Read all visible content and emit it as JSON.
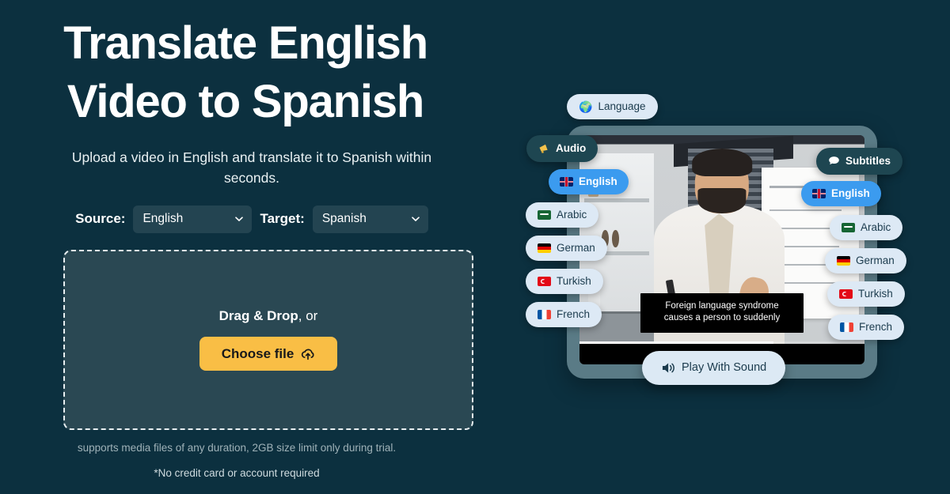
{
  "hero": {
    "title_line1": "Translate English",
    "title_line2": "Video to Spanish",
    "subtitle": "Upload a video in English and translate it to Spanish within seconds."
  },
  "form": {
    "source_label": "Source:",
    "source_value": "English",
    "source_options": [
      "English"
    ],
    "target_label": "Target:",
    "target_value": "Spanish",
    "target_options": [
      "Spanish"
    ],
    "dropzone": {
      "drag_strong": "Drag & Drop",
      "drag_rest": ", or",
      "button_label": "Choose file",
      "button_icon": "cloud-upload-icon"
    },
    "fineprint_1": "supports media files of any duration, 2GB size limit only during trial.",
    "fineprint_2": "*No credit card or account required"
  },
  "preview": {
    "language_chip": {
      "label": "Language",
      "icon": "globe-icon"
    },
    "audio_chip": {
      "label": "Audio",
      "icon": "megaphone-icon"
    },
    "subtitles_chip": {
      "label": "Subtitles",
      "icon": "speech-bubble-icon"
    },
    "audio_languages": [
      {
        "label": "English",
        "flag": "flag-gb",
        "selected": true
      },
      {
        "label": "Arabic",
        "flag": "flag-sa",
        "selected": false
      },
      {
        "label": "German",
        "flag": "flag-de",
        "selected": false
      },
      {
        "label": "Turkish",
        "flag": "flag-tr",
        "selected": false
      },
      {
        "label": "French",
        "flag": "flag-fr",
        "selected": false
      }
    ],
    "subtitle_languages": [
      {
        "label": "English",
        "flag": "flag-gb",
        "selected": true
      },
      {
        "label": "Arabic",
        "flag": "flag-sa",
        "selected": false
      },
      {
        "label": "German",
        "flag": "flag-de",
        "selected": false
      },
      {
        "label": "Turkish",
        "flag": "flag-tr",
        "selected": false
      },
      {
        "label": "French",
        "flag": "flag-fr",
        "selected": false
      }
    ],
    "caption_line1": "Foreign language syndrome",
    "caption_line2": "causes a person to suddenly",
    "play_button": {
      "label": "Play With Sound",
      "icon": "speaker-icon"
    }
  },
  "colors": {
    "background": "#0c303f",
    "accent_button": "#f9be45",
    "chip_selected": "#3b9bef",
    "chip_light": "#dde9f5",
    "chip_dark": "#1e4651",
    "dropzone_fill": "#2a4853"
  }
}
